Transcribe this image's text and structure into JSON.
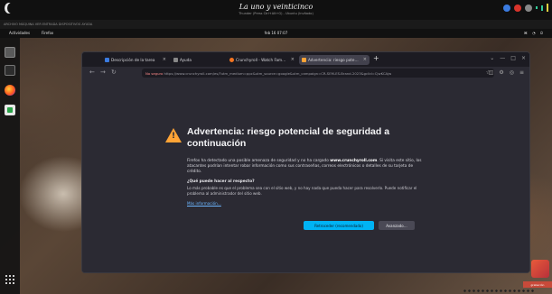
{
  "desktop": {
    "top_title": "La uno y veinticinco",
    "top_subtitle": "Thunder (Press Ctrl+Alt+G) - Ubuntu (Invitado)",
    "mini_bar_text": "ARCHIVO  MÁQUINA  VER  ENTRADA  DISPOSITIVOS  AYUDA",
    "activities": "Actividades",
    "app_name": "Firefox",
    "clock": "feb 16  07:07",
    "status_icons": "⌘ ◔ ⏻"
  },
  "browser": {
    "tabs": [
      {
        "label": "Descripción de la tarea"
      },
      {
        "label": "Ayuda"
      },
      {
        "label": "Crunchyroll - Watch Fam…"
      },
      {
        "label": "Advertencia: riesgo pote…"
      }
    ],
    "new_tab": "+",
    "url_prefix": "No seguro",
    "url": "https://www.crunchyroll.com/es/?utm_medium=ppc&utm_source=google&utm_campaign=CR-SEM-ES-Brand-2023&gclid=CjwKCAjw",
    "content": {
      "title": "Advertencia: riesgo potencial de seguridad a continuación",
      "description_pre": "Firefox ha detectado una posible amenaza de seguridad y no ha cargado ",
      "description_site": "www.crunchyroll.com",
      "description_post": ". Si visita este sitio, los atacantes podrían intentar robar información como sus contraseñas, correos electrónicos o detalles de su tarjeta de crédito.",
      "subheading": "¿Qué puede hacer al respecto?",
      "detail": "Lo más probable es que el problema sea con el sitio web, y no hay nada que pueda hacer para resolverlo. Puede notificar el problema al administrador del sitio web.",
      "learn_more": "Más información…",
      "primary_button": "Retroceder (recomendado)",
      "advanced_button": "Avanzado…"
    }
  },
  "corner": {
    "caption": "grabación"
  },
  "colors": {
    "accent": "#00b3f4",
    "warning": "#ffa436",
    "page_bg": "#2b2a33"
  }
}
